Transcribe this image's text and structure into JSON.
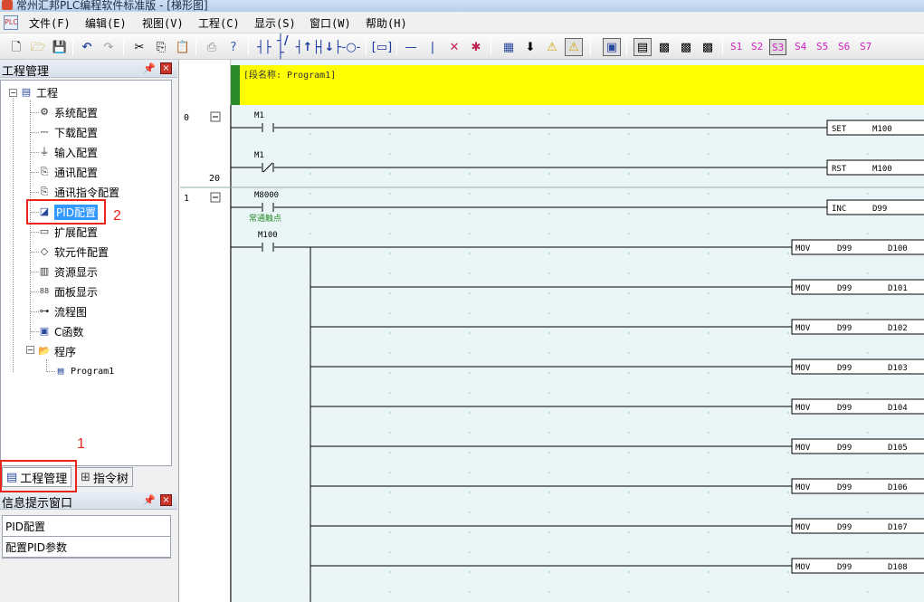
{
  "window": {
    "title": "常州汇邦PLC编程软件标准版 - [梯形图]"
  },
  "menu": [
    "文件(F)",
    "编辑(E)",
    "视图(V)",
    "工程(C)",
    "显示(S)",
    "窗口(W)",
    "帮助(H)"
  ],
  "toolbar": {
    "icons": [
      "new-file-icon",
      "open-folder-icon",
      "save-icon",
      "undo-icon",
      "redo-icon",
      "cut-icon",
      "copy-icon",
      "paste-icon",
      "print-icon",
      "help-icon",
      "no-contact-icon",
      "nc-contact-icon",
      "rising-contact-icon",
      "falling-contact-icon",
      "coil-icon",
      "function-box-icon",
      "hline-icon",
      "vline-icon",
      "delete-hline-icon",
      "delete-vline-icon",
      "compile-icon",
      "download-icon",
      "warning-icon",
      "warning-box-icon",
      "monitor-icon",
      "ladder-view-icon",
      "chip-icon",
      "chip2-icon",
      "chip3-icon"
    ],
    "s_buttons": [
      "S1",
      "S2",
      "S3",
      "S4",
      "S5",
      "S6",
      "S7"
    ],
    "active_s": "S3"
  },
  "project_panel": {
    "title": "工程管理",
    "root": "工程",
    "items": [
      "系统配置",
      "下载配置",
      "输入配置",
      "通讯配置",
      "通讯指令配置",
      "PID配置",
      "扩展配置",
      "软元件配置",
      "资源显示",
      "面板显示",
      "流程图",
      "C函数",
      "程序"
    ],
    "program": "Program1",
    "selected": "PID配置"
  },
  "tabs": [
    "工程管理",
    "指令树"
  ],
  "info_panel": {
    "title": "信息提示窗口",
    "rows": [
      "PID配置",
      "配置PID参数"
    ]
  },
  "annotations": {
    "box1_label": "1",
    "box2_label": "2"
  },
  "ladder": {
    "segment_label": "[段名称: Program1]",
    "gutter": {
      "step0": "0",
      "step20": "20",
      "step1": "1"
    },
    "rungs": [
      {
        "contact": "M1",
        "contact_type": "NO",
        "instr": "SET",
        "op1": "M100",
        "op2": ""
      },
      {
        "contact": "M1",
        "contact_type": "NC",
        "instr": "RST",
        "op1": "M100",
        "op2": ""
      },
      {
        "contact": "M8000",
        "contact_type": "NO",
        "comment": "常通触点",
        "instr": "INC",
        "op1": "D99",
        "op2": ""
      }
    ],
    "mov_contact": "M100",
    "mov_rows": [
      {
        "instr": "MOV",
        "src": "D99",
        "dst": "D100"
      },
      {
        "instr": "MOV",
        "src": "D99",
        "dst": "D101"
      },
      {
        "instr": "MOV",
        "src": "D99",
        "dst": "D102"
      },
      {
        "instr": "MOV",
        "src": "D99",
        "dst": "D103"
      },
      {
        "instr": "MOV",
        "src": "D99",
        "dst": "D104"
      },
      {
        "instr": "MOV",
        "src": "D99",
        "dst": "D105"
      },
      {
        "instr": "MOV",
        "src": "D99",
        "dst": "D106"
      },
      {
        "instr": "MOV",
        "src": "D99",
        "dst": "D107"
      },
      {
        "instr": "MOV",
        "src": "D99",
        "dst": "D108"
      }
    ]
  },
  "colors": {
    "segment_bg": "#ffff00",
    "segment_bar": "#2b8a2b",
    "comment": "#2a8a2a",
    "highlight": "#e8261e",
    "selection": "#3399ff"
  }
}
